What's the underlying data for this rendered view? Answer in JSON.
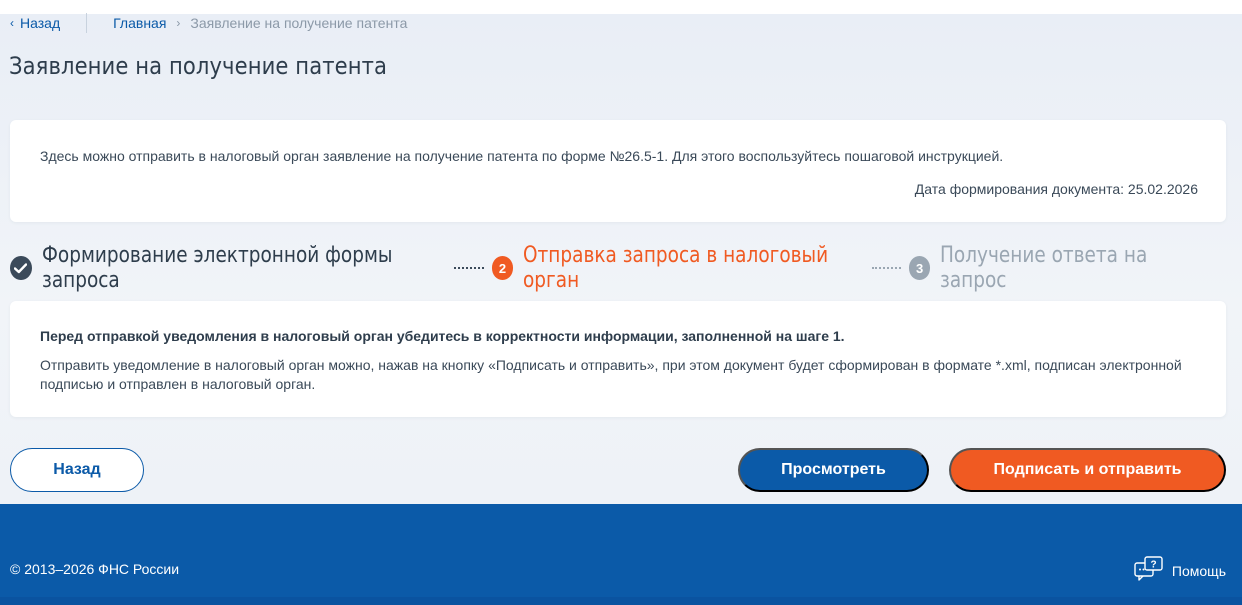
{
  "breadcrumb": {
    "back_label": "Назад",
    "home_label": "Главная",
    "current_label": "Заявление на получение патента"
  },
  "page": {
    "title": "Заявление на получение патента"
  },
  "info": {
    "text": "Здесь можно отправить в налоговый орган заявление на получение патента по форме №26.5-1. Для этого воспользуйтесь пошаговой инструкцией.",
    "date_text": "Дата формирования документа: 25.02.2026"
  },
  "steps": [
    {
      "number": "",
      "label": "Формирование электронной формы запроса",
      "state": "done"
    },
    {
      "number": "2",
      "label": "Отправка запроса в налоговый орган",
      "state": "active"
    },
    {
      "number": "3",
      "label": "Получение ответа на запрос",
      "state": "todo"
    }
  ],
  "note": {
    "bold": "Перед отправкой уведомления в налоговый орган убедитесь в корректности информации, заполненной на шаге 1.",
    "text": "Отправить уведомление в налоговый орган можно, нажав на кнопку «Подписать и отправить», при этом документ будет сформирован в формате *.xml, подписан электронной подписью и отправлен в налоговый орган."
  },
  "actions": {
    "back_label": "Назад",
    "preview_label": "Просмотреть",
    "sign_label": "Подписать и отправить"
  },
  "footer": {
    "copyright": "© 2013–2026 ФНС России",
    "help_label": "Помощь"
  },
  "colors": {
    "primary": "#0b5aa8",
    "accent": "#f05a22",
    "done": "#3b4a5a",
    "todo": "#9aa6b2"
  }
}
